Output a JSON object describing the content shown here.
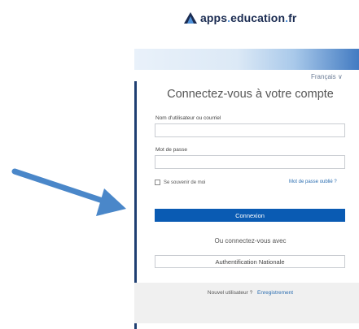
{
  "logo": {
    "name_main": "apps",
    "sep1": ".",
    "name_mid": "education",
    "sep2": ".",
    "name_tld": "fr"
  },
  "login": {
    "language": "Français ∨",
    "title": "Connectez-vous à votre compte",
    "username_label": "Nom d'utilisateur ou courriel",
    "username_value": "",
    "password_label": "Mot de passe",
    "password_value": "",
    "remember_label": "Se souvenir de moi",
    "forgot_link": "Mot de passe oublié ?",
    "submit_label": "Connexion",
    "alt_text": "Ou connectez-vous avec",
    "national_auth_label": "Authentification Nationale",
    "new_user_text": "Nouvel utilisateur ?",
    "register_link": "Enregistrement"
  },
  "colors": {
    "primary_button": "#0a5bb3",
    "link": "#2a6db0",
    "arrow": "#4a87c9"
  }
}
